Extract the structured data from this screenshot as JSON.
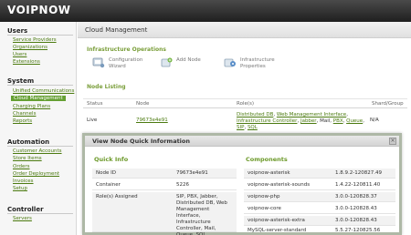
{
  "app": {
    "logo_text": "VOIPNOW"
  },
  "sidebar": {
    "sections": [
      {
        "title": "Users",
        "items": [
          "Service Providers",
          "Organizations",
          "Users",
          "Extensions"
        ]
      },
      {
        "title": "System",
        "items": [
          "Unified Communications",
          "Cloud Management",
          "Charging Plans",
          "Channels",
          "Reports"
        ]
      },
      {
        "title": "Automation",
        "items": [
          "Customer Accounts",
          "Store Items",
          "Orders",
          "Order Deployment",
          "Invoices",
          "Setup"
        ]
      },
      {
        "title": "Controller",
        "items": [
          "Servers"
        ]
      }
    ],
    "active_item": "Cloud Management"
  },
  "main": {
    "page_title": "Cloud Management",
    "infrastructure_operations": "Infrastructure Operations",
    "toolbar": [
      {
        "label": "Configuration Wizard",
        "icon": "configuration-wizard-icon"
      },
      {
        "label": "Add Node",
        "icon": "add-node-icon"
      },
      {
        "label": "Infrastructure Properties",
        "icon": "infrastructure-properties-icon"
      }
    ],
    "node_listing": "Node Listing",
    "columns": [
      "Status",
      "Node",
      "Role(s)",
      "Shard/Group"
    ],
    "row": {
      "status": "Live",
      "node": "79673e4e91",
      "roles_links": [
        "Distributed DB",
        "Web Management Interface",
        "Infrastructure Controller",
        "Jabber"
      ],
      "roles_plain": "Mail",
      "roles_links_2": [
        "PBX",
        "Queue",
        "SIP",
        "SQL"
      ],
      "shard": "N/A"
    }
  },
  "modal": {
    "title": "View Node Quick Information",
    "quick_info_title": "Quick Info",
    "components_title": "Components",
    "quick_info": [
      {
        "key": "Node ID",
        "value": "79673e4e91"
      },
      {
        "key": "Container",
        "value": "5226"
      },
      {
        "key": "Role(s) Assigned",
        "value": "SIP, PBX, Jabber, Distributed DB, Web Management Interface, Infrastructure Controller, Mail, Queue, SQL"
      }
    ],
    "components": [
      {
        "name": "voipnow-asterisk",
        "version": "1.8.9.2-120827.49"
      },
      {
        "name": "voipnow-asterisk-sounds",
        "version": "1.4.22-120811.40"
      },
      {
        "name": "voipnow-php",
        "version": "3.0.0-120828.37"
      },
      {
        "name": "voipnow-core",
        "version": "3.0.0-120828.43"
      },
      {
        "name": "voipnow-asterisk-extra",
        "version": "3.0.0-120828.43"
      },
      {
        "name": "MySQL-server-standard",
        "version": "5.5.27-120825.56"
      }
    ]
  }
}
